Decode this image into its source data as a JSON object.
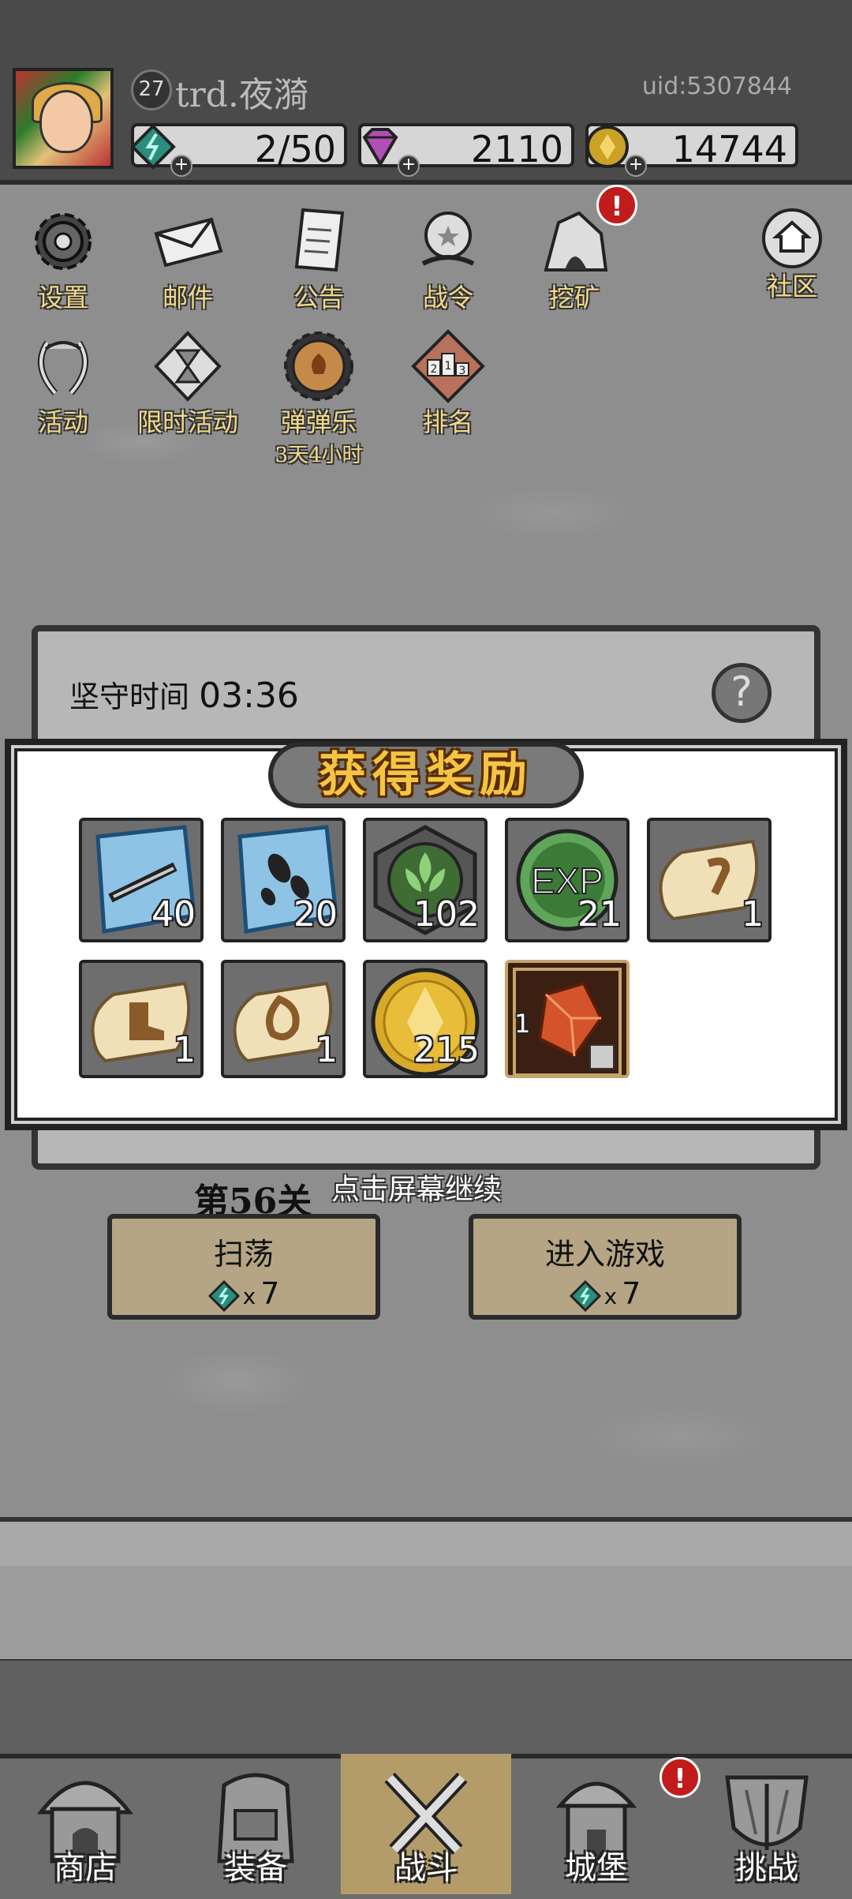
{
  "player": {
    "level": "27",
    "name": "trd.夜漪",
    "uid": "uid:5307844"
  },
  "resources": {
    "stamina": "2/50",
    "diamonds": "2110",
    "gold": "14744"
  },
  "menu": {
    "settings": "设置",
    "mail": "邮件",
    "notice": "公告",
    "battle_pass": "战令",
    "mining": "挖矿",
    "community": "社区",
    "events": "活动",
    "limited_events": "限时活动",
    "pinball": "弹弹乐",
    "pinball_timer": "3天4小时",
    "ranking": "排名",
    "ranking_icon_digits": [
      "2",
      "1",
      "3"
    ]
  },
  "notification_mark": "!",
  "level_panel": {
    "hold_time_label": "坚守时间",
    "hold_time_value": "03:36",
    "help_symbol": "?"
  },
  "reward": {
    "title": "获得奖励",
    "items": [
      {
        "icon": "blue-crystal-sword-icon",
        "qty": "40"
      },
      {
        "icon": "blue-crystal-drops-icon",
        "qty": "20"
      },
      {
        "icon": "green-leaf-emblem-icon",
        "qty": "102"
      },
      {
        "icon": "exp-coin-icon",
        "label": "EXP",
        "qty": "21"
      },
      {
        "icon": "scroll-hook-icon",
        "qty": "1"
      },
      {
        "icon": "scroll-boot-icon",
        "qty": "1"
      },
      {
        "icon": "scroll-rune-icon",
        "qty": "1"
      },
      {
        "icon": "gold-coin-icon",
        "qty": "215"
      },
      {
        "icon": "red-gem-icon",
        "qty": "1"
      }
    ]
  },
  "stage": {
    "label": "第56关",
    "continue_hint": "点击屏幕继续",
    "sweep_label": "扫荡",
    "sweep_cost": "7",
    "enter_label": "进入游戏",
    "enter_cost": "7",
    "multiply": "x"
  },
  "nav": {
    "shop": "商店",
    "equipment": "装备",
    "battle": "战斗",
    "castle": "城堡",
    "challenge": "挑战"
  },
  "colors": {
    "header": "#4a4a4a",
    "accent_gold": "#f4c542",
    "notification_red": "#c21b1b",
    "active_tab": "#b39c6a"
  }
}
